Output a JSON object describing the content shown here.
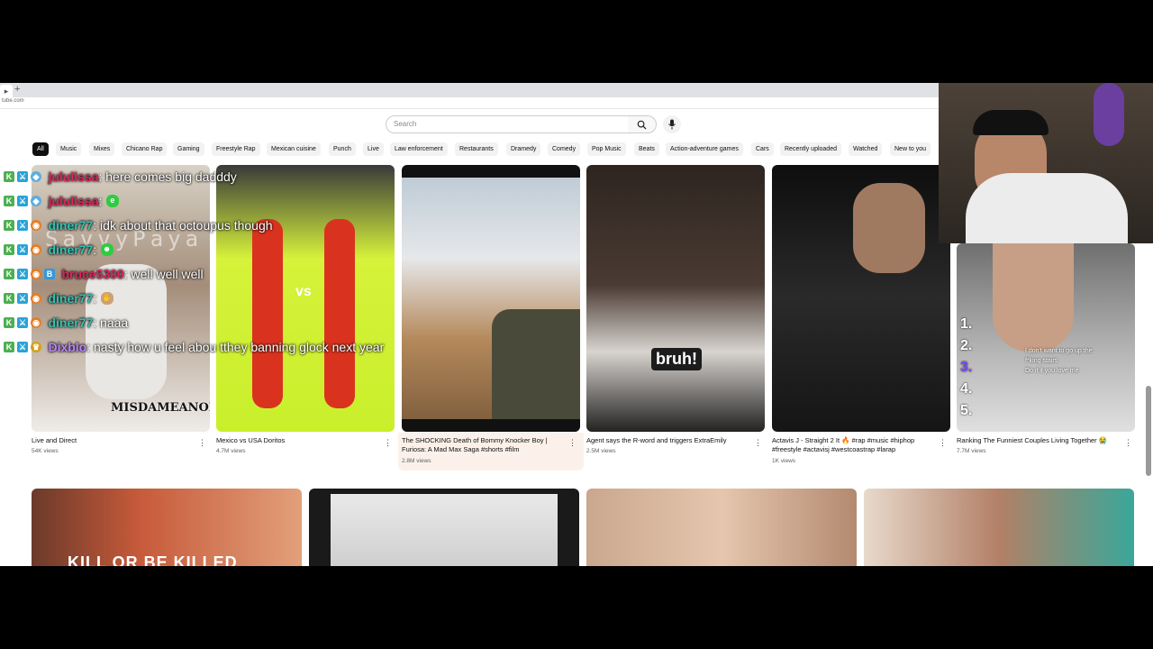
{
  "browser": {
    "new_tab": "+",
    "url": "tube.com"
  },
  "search": {
    "placeholder": "Search"
  },
  "chips": [
    "All",
    "Music",
    "Mixes",
    "Chicano Rap",
    "Gaming",
    "Freestyle Rap",
    "Mexican cuisine",
    "Punch",
    "Live",
    "Law enforcement",
    "Restaurants",
    "Dramedy",
    "Comedy",
    "Pop Music",
    "Beats",
    "Action-adventure games",
    "Cars",
    "Recently uploaded",
    "Watched",
    "New to you"
  ],
  "videos": [
    {
      "title": "Live and Direct",
      "views": "54K views",
      "overlay": "MISDAMEANOR"
    },
    {
      "title": "Mexico vs USA Doritos",
      "views": "4.7M views",
      "overlay": "vs"
    },
    {
      "title": "The SHOCKING Death of Bommy Knocker Boy | Furiosa: A Mad Max Saga #shorts #film",
      "views": "2.8M views"
    },
    {
      "title": "Agent says the R-word and triggers ExtraEmily",
      "views": "2.5M views",
      "overlay": "bruh!"
    },
    {
      "title": "Actavis J - Straight 2 It 🔥 #rap #music #hiphop #freestyle #actavisj #westcoastrap #larap",
      "views": "1K views"
    },
    {
      "title": "Ranking The Funniest Couples Living Together 😭",
      "views": "7.7M views",
      "overlay_lines": [
        "I don't want to go up the",
        "f*king stairs",
        "Do it if you love me"
      ]
    }
  ],
  "row2_overlay": "KILL OR BE KILLED",
  "overlay_watermark": "SavvyPaya",
  "chat": [
    {
      "user": "jululissa",
      "msg": ": here comes big dadddy",
      "color": "#e0245e",
      "badges": [
        "K",
        "S",
        "shield"
      ]
    },
    {
      "user": "jululissa",
      "msg": ":",
      "color": "#e0245e",
      "badges": [
        "K",
        "S",
        "shield"
      ]
    },
    {
      "user": "diner77",
      "msg": ": idk about that octoupus though",
      "color": "#2ec4b6",
      "badges": [
        "K",
        "S",
        "fox"
      ]
    },
    {
      "user": "diner77",
      "msg": ":",
      "color": "#2ec4b6",
      "badges": [
        "K",
        "S",
        "fox"
      ]
    },
    {
      "user": "bruce5300",
      "msg": ": well well well",
      "color": "#e0245e",
      "badges": [
        "K",
        "S",
        "fox",
        "bs"
      ]
    },
    {
      "user": "diner77",
      "msg": ":",
      "color": "#2ec4b6",
      "badges": [
        "K",
        "S",
        "fox"
      ]
    },
    {
      "user": "diner77",
      "msg": ": naaa",
      "color": "#2ec4b6",
      "badges": [
        "K",
        "S",
        "fox"
      ]
    },
    {
      "user": "Dixblo",
      "msg": ": nasty how u feel abou tthey banning glock next year",
      "color": "#b983ff",
      "badges": [
        "K",
        "S",
        "crown"
      ]
    }
  ],
  "colors": {
    "chip_active": "#0f0f0f",
    "chip": "#f2f2f2",
    "kick_green": "#4caf50"
  }
}
